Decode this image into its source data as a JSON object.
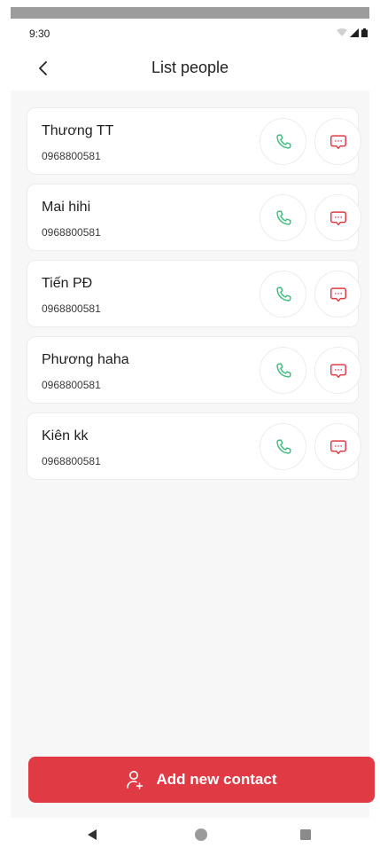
{
  "status_bar": {
    "time": "9:30"
  },
  "header": {
    "title": "List people"
  },
  "contacts": [
    {
      "name": "Thương TT",
      "phone": "0968800581"
    },
    {
      "name": "Mai hihi",
      "phone": "0968800581"
    },
    {
      "name": "Tiến PĐ",
      "phone": "0968800581"
    },
    {
      "name": "Phương haha",
      "phone": "0968800581"
    },
    {
      "name": "Kiên kk",
      "phone": "0968800581"
    }
  ],
  "add_button": {
    "label": "Add new contact"
  },
  "colors": {
    "accent": "#e03a45",
    "call_icon": "#3fbf7f",
    "message_icon": "#e03a45"
  },
  "icons": {
    "back": "back-arrow-icon",
    "call": "phone-icon",
    "message": "message-icon",
    "add_contact": "user-plus-icon"
  }
}
